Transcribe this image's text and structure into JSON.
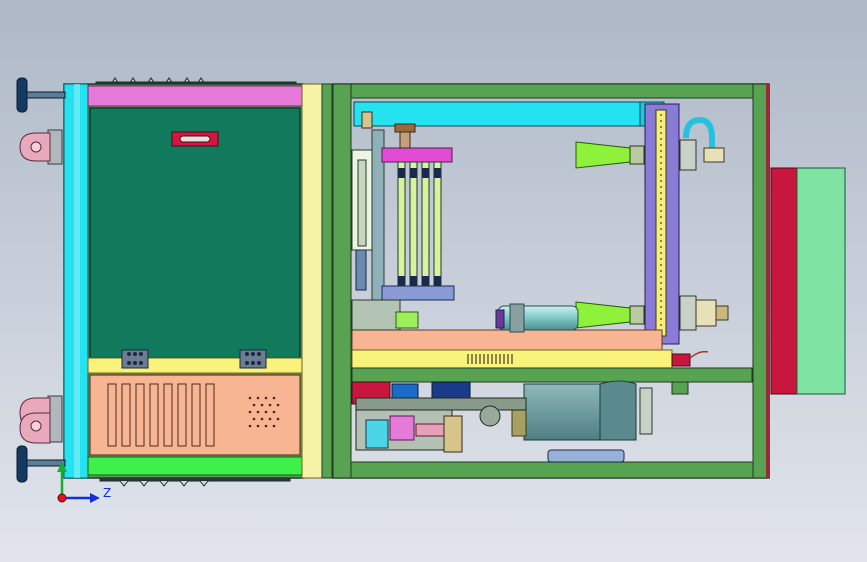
{
  "viewport": {
    "background_top": "#aeb8c7",
    "background_bottom": "#dfe3ea"
  },
  "triad": {
    "axis_z_label": "Z",
    "x_color": "#e8101c",
    "y_color": "#10b030",
    "z_color": "#1030e0"
  },
  "colors": {
    "cyan": "#25e2f0",
    "magenta": "#e67ad9",
    "green_panel": "#117a5d",
    "yellow": "#faf37b",
    "light_yellow": "#f6f3a6",
    "salmon": "#f7b594",
    "light_green": "#7fe3a4",
    "crimson": "#c9163f",
    "frame_green": "#57a352",
    "foot_navy": "#143a63",
    "pink_wheel": "#e9a9bd",
    "lime": "#9bf05a",
    "steel": "#7db3b7"
  }
}
